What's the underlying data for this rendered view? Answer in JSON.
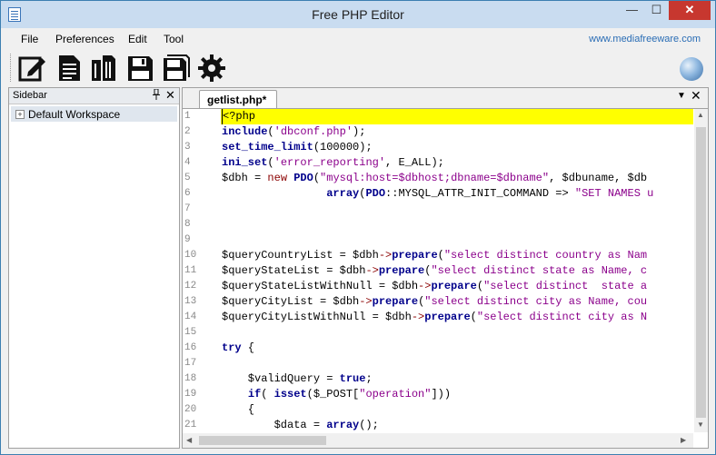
{
  "window": {
    "title": "Free PHP Editor",
    "min": "—",
    "max": "☐",
    "close": "✕"
  },
  "menu": {
    "items": [
      "File",
      "Preferences",
      "Edit",
      "Tool"
    ],
    "link": "www.mediafreeware.com"
  },
  "toolbar": {
    "buttons": [
      "edit-icon",
      "new-file-icon",
      "open-files-icon",
      "save-icon",
      "save-all-icon",
      "settings-icon"
    ],
    "globe": "globe-icon"
  },
  "sidebar": {
    "title": "Sidebar",
    "pin": "📌",
    "close": "✕",
    "items": [
      {
        "expander": "+",
        "label": "Default Workspace"
      }
    ]
  },
  "editor": {
    "tab": "getlist.php*",
    "tab_menu": "▼",
    "tab_close": "✕",
    "lines": [
      {
        "n": "1",
        "text": "<?php"
      },
      {
        "n": "2",
        "text": "include('dbconf.php');"
      },
      {
        "n": "3",
        "text": "set_time_limit(100000);"
      },
      {
        "n": "4",
        "text": "ini_set('error_reporting', E_ALL);"
      },
      {
        "n": "5",
        "text": "$dbh = new PDO(\"mysql:host=$dbhost;dbname=$dbname\", $dbuname, $db"
      },
      {
        "n": "6",
        "text": "                array(PDO::MYSQL_ATTR_INIT_COMMAND => \"SET NAMES u"
      },
      {
        "n": "7",
        "text": ""
      },
      {
        "n": "8",
        "text": ""
      },
      {
        "n": "9",
        "text": ""
      },
      {
        "n": "10",
        "text": "$queryCountryList = $dbh->prepare(\"select distinct country as Nam"
      },
      {
        "n": "11",
        "text": "$queryStateList = $dbh->prepare(\"select distinct state as Name, c"
      },
      {
        "n": "12",
        "text": "$queryStateListWithNull = $dbh->prepare(\"select distinct  state a"
      },
      {
        "n": "13",
        "text": "$queryCityList = $dbh->prepare(\"select distinct city as Name, cou"
      },
      {
        "n": "14",
        "text": "$queryCityListWithNull = $dbh->prepare(\"select distinct city as N"
      },
      {
        "n": "15",
        "text": ""
      },
      {
        "n": "16",
        "text": "try {"
      },
      {
        "n": "17",
        "text": ""
      },
      {
        "n": "18",
        "text": "    $validQuery = true;"
      },
      {
        "n": "19",
        "text": "    if( isset($_POST[\"operation\"]))"
      },
      {
        "n": "20",
        "text": "    {"
      },
      {
        "n": "21",
        "text": "        $data = array();"
      }
    ]
  }
}
